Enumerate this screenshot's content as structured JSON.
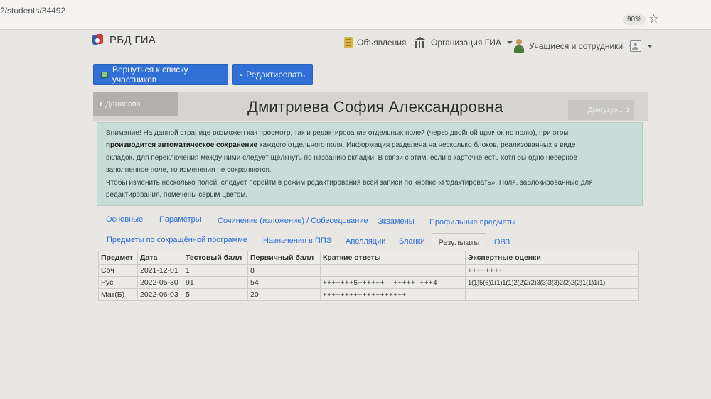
{
  "browser": {
    "url": "?/students/34492",
    "zoom": "90%"
  },
  "navbar": {
    "brand": "РБД ГИА",
    "announcements": "Объявления",
    "organization": "Организация ГИА",
    "people": "Учащиеся и сотрудники"
  },
  "actions": {
    "back_label": "Вернуться к списку участников",
    "edit_label": "Редактировать"
  },
  "student": {
    "prev": "Денисова...",
    "name": "Дмитриева София Александровна",
    "next": "Донгузур..."
  },
  "alert": {
    "line1": "Внимание! На данной странице возможен как просмотр, так и редактирование отдельных полей (через двойной щелчок по полю), при этом",
    "line2_bold": "производится автоматическое сохранение",
    "line2_rest": " каждого отдельного поля. Информация разделена на несколько блоков, реализованных в виде",
    "line3": "вкладок. Для переключения между ними следует щёлкнуть по названию вкладки. В связи с этим, если в карточке есть хотя бы одно неверное",
    "line4": "заполненное поле, то изменения не сохраняются.",
    "line5": "Чтобы изменить несколько полей, следует перейти в режим редактирования всей записи по кнопке «Редактировать». Поля, заблокированные для",
    "line6": "редактирования, помечены серым цветом."
  },
  "tabs": {
    "row1": [
      "Основные",
      "Параметры",
      "Сочинение (изложение) / Собеседование",
      "Экзамены",
      "Профильные предметы"
    ],
    "row2": [
      "Предметы по сокращённой программе",
      "Назначения в ППЭ",
      "Апелляции",
      "Бланки",
      "Результаты",
      "ОВЗ"
    ],
    "active": "Результаты"
  },
  "results": {
    "headers": [
      "Предмет",
      "Дата",
      "Тестовый балл",
      "Первичный балл",
      "Краткие ответы",
      "Экспертные оценки"
    ],
    "rows": [
      [
        "Соч",
        "2021-12-01",
        "1",
        "8",
        "",
        "++++++++"
      ],
      [
        "Рус",
        "2022-05-30",
        "91",
        "54",
        "+++++++5++++++--+++++-+++4",
        "1(1)5(6)1(1)1(1)2(2)2(2)3(3)3(3)2(2)2(2)1(1)1(1)"
      ],
      [
        "Мат(Б)",
        "2022-06-03",
        "5",
        "20",
        "+++++++++++++++++++-",
        ""
      ]
    ]
  }
}
